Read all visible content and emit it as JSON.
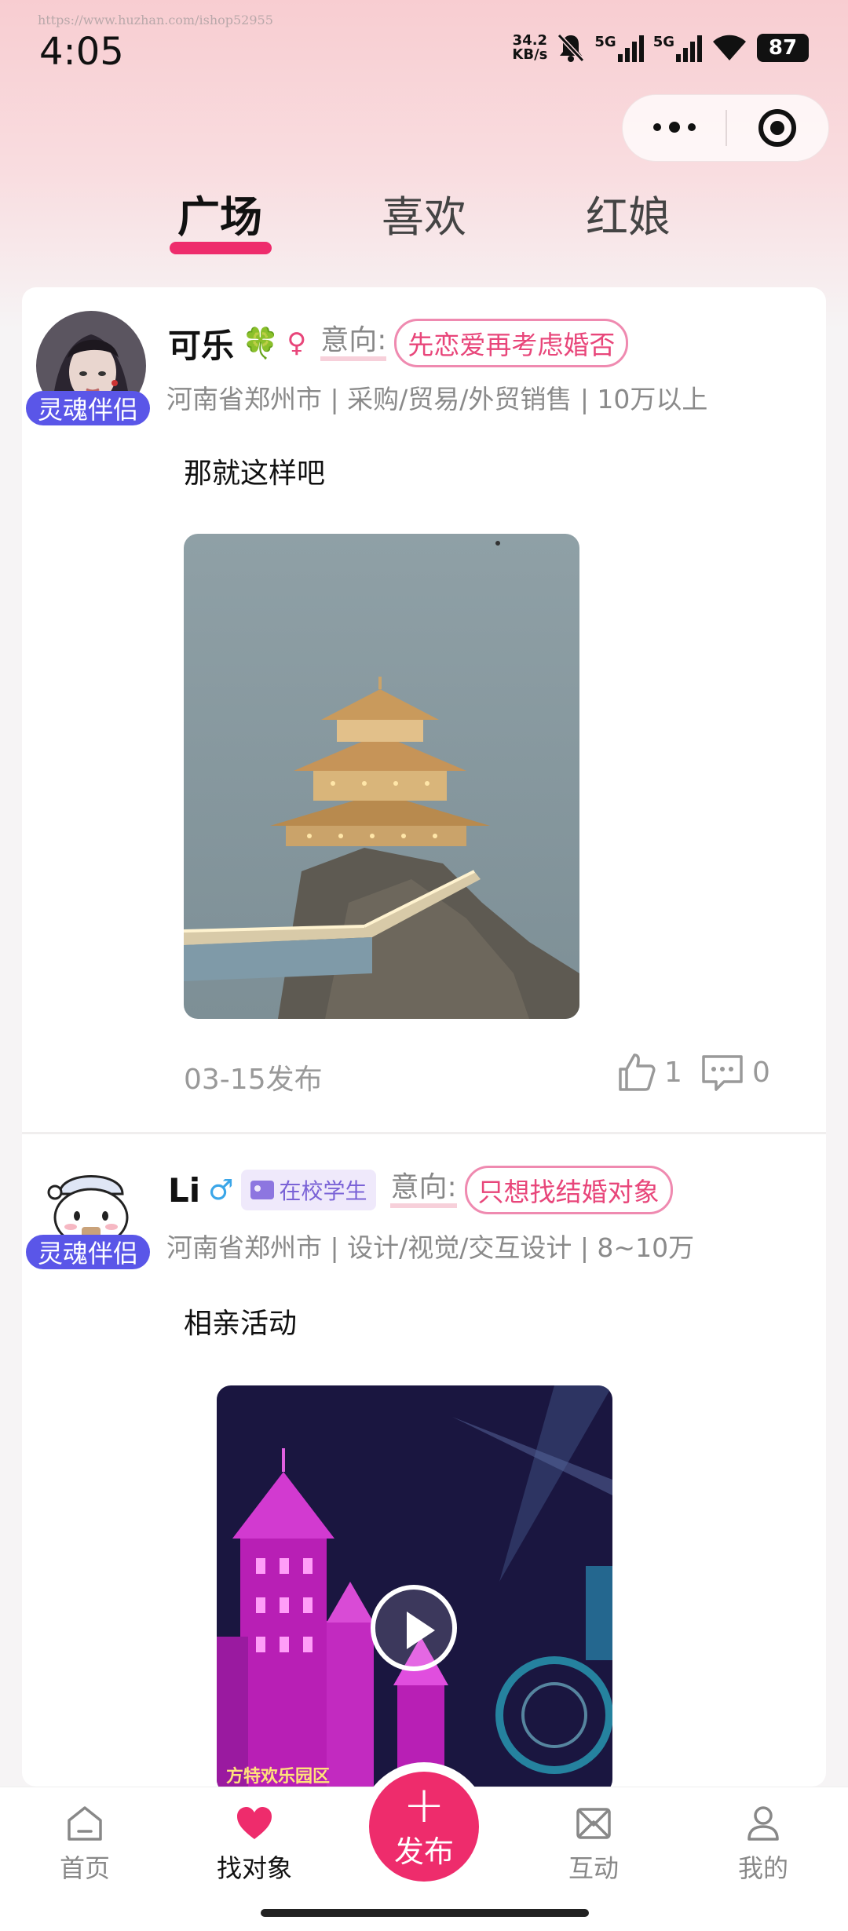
{
  "watermark": "https://www.huzhan.com/ishop52955",
  "status_bar": {
    "time": "4:05",
    "net_speed_value": "34.2",
    "net_speed_unit": "KB/s",
    "sim1": "5G",
    "sim2": "5G",
    "battery": "87",
    "icons": [
      "bell-off-icon",
      "signal-icon",
      "signal-icon",
      "wifi-icon",
      "battery-icon"
    ]
  },
  "capsule": {
    "more_icon": "more-dots-icon",
    "close_icon": "target-icon"
  },
  "tabs": [
    {
      "label": "广场",
      "active": true
    },
    {
      "label": "喜欢",
      "active": false
    },
    {
      "label": "红娘",
      "active": false
    }
  ],
  "posts": [
    {
      "name": "可乐",
      "emoji": "🍀",
      "gender": "♀",
      "badge": "灵魂伴侣",
      "intent_label": "意向:",
      "intent": "先恋爱再考虑婚否",
      "meta": "河南省郑州市 | 采购/贸易/外贸销售 | 10万以上",
      "text": "那就这样吧",
      "date": "03-15发布",
      "likes": "1",
      "comments": "0"
    },
    {
      "name": "Li",
      "gender": "♂",
      "student_tag": "在校学生",
      "badge": "灵魂伴侣",
      "intent_label": "意向:",
      "intent": "只想找结婚对象",
      "meta": "河南省郑州市 | 设计/视觉/交互设计 | 8~10万",
      "text": "相亲活动",
      "video_caption": "方特欢乐园区"
    }
  ],
  "tabbar": {
    "items": [
      {
        "label": "首页",
        "icon": "home-icon"
      },
      {
        "label": "找对象",
        "icon": "heart-icon",
        "active": true
      },
      {
        "label": "发布",
        "icon": "plus-icon"
      },
      {
        "label": "互动",
        "icon": "interact-icon"
      },
      {
        "label": "我的",
        "icon": "profile-icon"
      }
    ]
  },
  "colors": {
    "accent": "#ee2c6c",
    "badge": "#5a56e8",
    "intent": "#e8467a"
  }
}
